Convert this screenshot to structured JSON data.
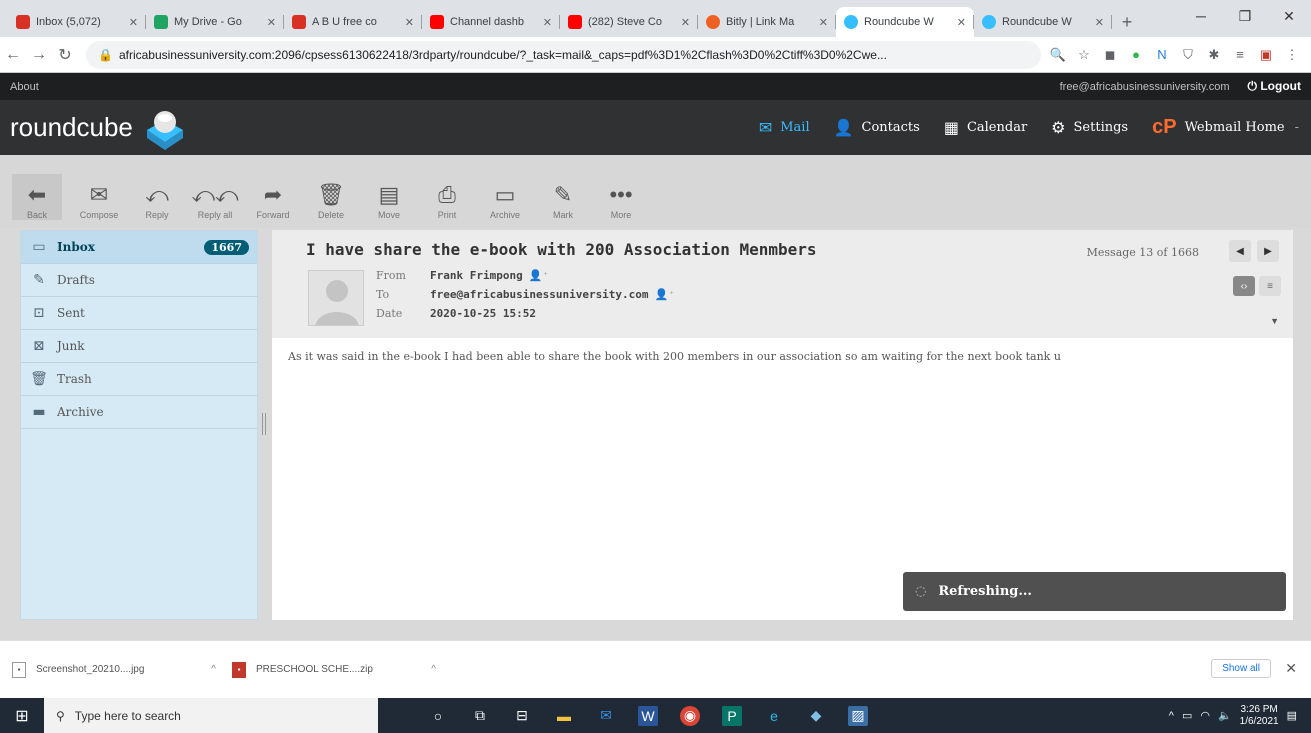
{
  "browser": {
    "tabs": [
      {
        "title": "Inbox (5,072)",
        "color": "#d93025"
      },
      {
        "title": "My Drive - Go",
        "color": "#1fa463"
      },
      {
        "title": "A B U free co",
        "color": "#d93025"
      },
      {
        "title": "Channel dashb",
        "color": "#ff0000"
      },
      {
        "title": "(282) Steve Co",
        "color": "#ff0000"
      },
      {
        "title": "Bitly | Link Ma",
        "color": "#ee6123"
      },
      {
        "title": "Roundcube W",
        "color": "#37beff"
      },
      {
        "title": "Roundcube W",
        "color": "#37beff"
      }
    ],
    "url": "africabusinessuniversity.com:2096/cpsess6130622418/3rdparty/roundcube/?_task=mail&_caps=pdf%3D1%2Cflash%3D0%2Ctiff%3D0%2Cwe..."
  },
  "topline": {
    "about": "About",
    "user_email": "free@africabusinessuniversity.com",
    "logout": "Logout"
  },
  "header": {
    "logo": "roundcube",
    "nav": [
      {
        "label": "Mail",
        "icon": "mail-icon"
      },
      {
        "label": "Contacts",
        "icon": "contacts-icon"
      },
      {
        "label": "Calendar",
        "icon": "calendar-icon"
      },
      {
        "label": "Settings",
        "icon": "gear-icon"
      },
      {
        "label": "Webmail Home",
        "icon": "cpanel-icon"
      }
    ]
  },
  "toolbar": {
    "back": "Back",
    "compose": "Compose",
    "reply": "Reply",
    "reply_all": "Reply all",
    "forward": "Forward",
    "delete": "Delete",
    "move": "Move",
    "print": "Print",
    "archive": "Archive",
    "mark": "Mark",
    "more": "More"
  },
  "folders": [
    {
      "label": "Inbox",
      "count": "1667"
    },
    {
      "label": "Drafts"
    },
    {
      "label": "Sent"
    },
    {
      "label": "Junk"
    },
    {
      "label": "Trash"
    },
    {
      "label": "Archive"
    }
  ],
  "message": {
    "subject": "I have share the e-book with 200 Association Menmbers",
    "from_label": "From",
    "from": "Frank Frimpong",
    "to_label": "To",
    "to": "free@africabusinessuniversity.com",
    "date_label": "Date",
    "date": "2020-10-25 15:52",
    "counter": "Message 13 of 1668",
    "body": "As it was said in the e-book I had been able to share the book with 200 members in our association so am waiting for the next book tank u"
  },
  "toast": "Refreshing...",
  "downloads": {
    "items": [
      "Screenshot_20210....jpg",
      "PRESCHOOL SCHE....zip"
    ],
    "show_all": "Show all"
  },
  "taskbar": {
    "search_placeholder": "Type here to search",
    "time": "3:26 PM",
    "date": "1/6/2021"
  }
}
